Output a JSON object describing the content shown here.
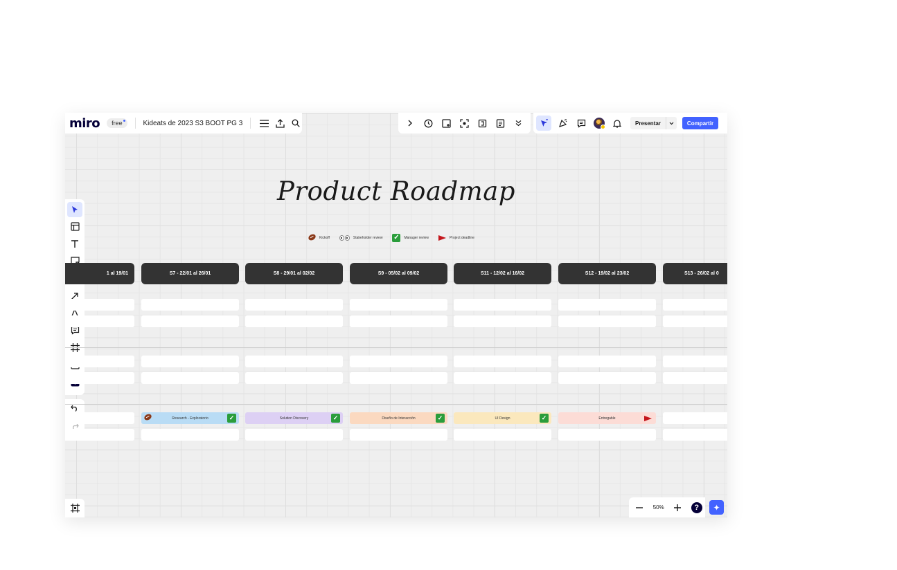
{
  "app": {
    "logo": "miro",
    "plan_badge": "free",
    "board_title": "Kideats de 2023 S3 BOOT PG 3"
  },
  "toolbar": {
    "present_label": "Presentar",
    "share_label": "Compartir",
    "zoom_level": "50%",
    "help_label": "?"
  },
  "board": {
    "title": "Product Roadmap",
    "legend": [
      {
        "icon": "football-icon",
        "label": "Kickoff"
      },
      {
        "icon": "eyes-icon",
        "label": "Stakeholder review"
      },
      {
        "icon": "checkmark-icon",
        "label": "Manager review"
      },
      {
        "icon": "red-flag-icon",
        "label": "Project deadline"
      }
    ],
    "weeks": [
      "1 al 19/01",
      "S7 - 22/01 al 26/01",
      "S8 - 29/01 al 02/02",
      "S9 - 05/02 al 09/02",
      "S11 - 12/02 al 16/02",
      "S12 - 19/02 al 23/02",
      "S13 - 26/02 al 0"
    ],
    "tasks": [
      {
        "label": "Research - Exploratorio",
        "color": "#b9dcf5",
        "icon": "football-icon",
        "marker": "checkmark-icon"
      },
      {
        "label": "Solution Discovery",
        "color": "#ddd0f4",
        "marker": "checkmark-icon"
      },
      {
        "label": "Diseño de Interacción",
        "color": "#fbd9c0",
        "marker": "checkmark-icon"
      },
      {
        "label": "UI Design",
        "color": "#fbe8bd",
        "marker": "checkmark-icon"
      },
      {
        "label": "Entregable",
        "color": "#fcdcd6",
        "marker": "red-flag-icon"
      }
    ]
  }
}
